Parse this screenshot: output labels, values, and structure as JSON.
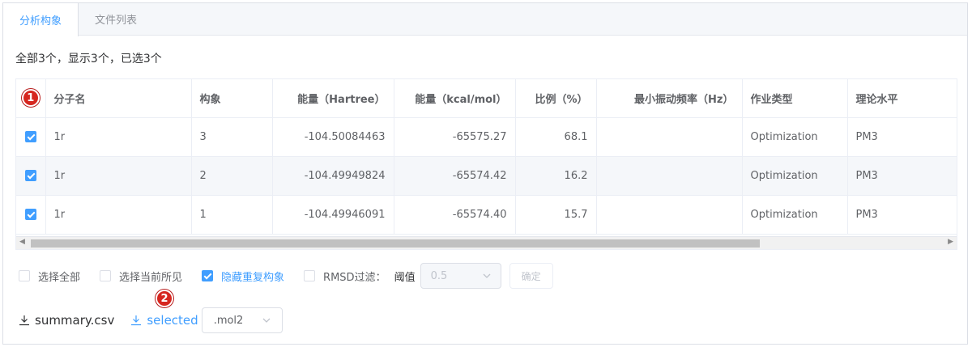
{
  "tabs": [
    {
      "label": "分析构象",
      "active": true
    },
    {
      "label": "文件列表",
      "active": false
    }
  ],
  "summary": "全部3个，显示3个，已选3个",
  "markers": {
    "one": "1",
    "two": "2"
  },
  "table": {
    "headers": [
      "分子名",
      "构象",
      "能量（Hartree）",
      "能量（kcal/mol）",
      "比例（%）",
      "最小振动频率（Hz）",
      "作业类型",
      "理论水平"
    ],
    "rows": [
      {
        "checked": true,
        "name": "1r",
        "conf": "3",
        "hartree": "-104.50084463",
        "kcal": "-65575.27",
        "ratio": "68.1",
        "freq": "",
        "job": "Optimization",
        "level": "PM3"
      },
      {
        "checked": true,
        "name": "1r",
        "conf": "2",
        "hartree": "-104.49949824",
        "kcal": "-65574.42",
        "ratio": "16.2",
        "freq": "",
        "job": "Optimization",
        "level": "PM3"
      },
      {
        "checked": true,
        "name": "1r",
        "conf": "1",
        "hartree": "-104.49946091",
        "kcal": "-65574.40",
        "ratio": "15.7",
        "freq": "",
        "job": "Optimization",
        "level": "PM3"
      }
    ]
  },
  "options": {
    "select_all": "选择全部",
    "select_visible": "选择当前所见",
    "hide_duplicates": "隐藏重复构象",
    "rmsd_filter": "RMSD过滤：",
    "threshold_label": "阈值",
    "threshold_value": "0.5",
    "confirm": "确定"
  },
  "downloads": {
    "summary": "summary.csv",
    "selected": "selected",
    "format": ".mol2"
  },
  "colors": {
    "accent": "#409eff",
    "marker": "#d6261f"
  }
}
